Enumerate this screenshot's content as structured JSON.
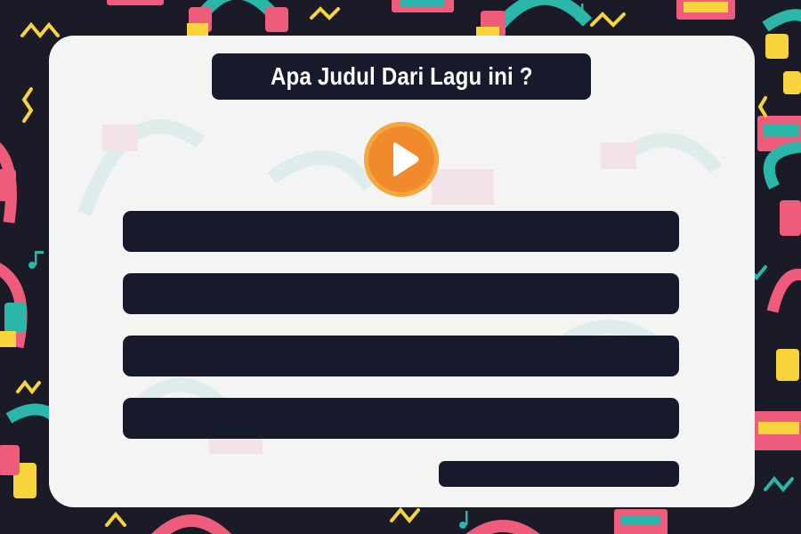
{
  "quiz": {
    "question": "Apa Judul Dari Lagu ini ?",
    "answers": [
      "",
      "",
      "",
      ""
    ],
    "submit_label": ""
  },
  "theme": {
    "background": "#1a1b26",
    "card": "#f4f4f5",
    "dark": "#171a2a",
    "accent_orange": "#f08a2c",
    "pink": "#ef5b7a",
    "teal": "#2ab7a9",
    "yellow": "#f7d33c"
  },
  "icons": {
    "play": "play-icon",
    "decor": [
      "headphones-icon",
      "cassette-icon",
      "music-note-icon",
      "squiggle-icon"
    ]
  }
}
